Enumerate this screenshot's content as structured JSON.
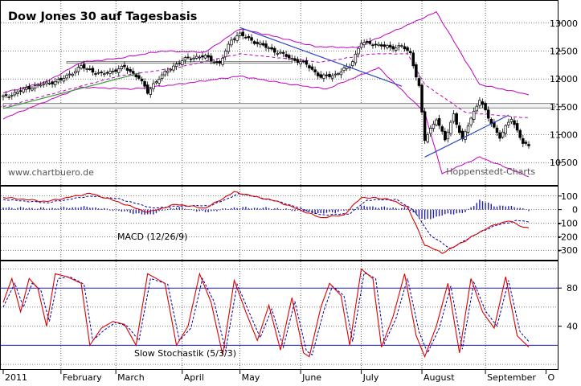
{
  "chart_data": [
    {
      "type": "candlestick",
      "title": "Dow Jones 30 auf Tagesbasis",
      "watermark": "www.chartbuero.de",
      "source": "Hoppenstedt-Charts",
      "ylim": [
        10100,
        13400
      ],
      "yticks": [
        10500,
        11000,
        11500,
        12000,
        12500,
        13000
      ],
      "xlim": [
        0,
        182
      ],
      "months": [
        {
          "label": "2011",
          "index": 0
        },
        {
          "label": "February",
          "index": 20
        },
        {
          "label": "March",
          "index": 39
        },
        {
          "label": "April",
          "index": 62
        },
        {
          "label": "May",
          "index": 82
        },
        {
          "label": "June",
          "index": 103
        },
        {
          "label": "July",
          "index": 124
        },
        {
          "label": "August",
          "index": 145
        },
        {
          "label": "September",
          "index": 167
        },
        {
          "label": "O",
          "index": 188
        }
      ],
      "close_keypoints": [
        [
          0,
          11670
        ],
        [
          10,
          11860
        ],
        [
          20,
          11980
        ],
        [
          27,
          12220
        ],
        [
          34,
          12080
        ],
        [
          42,
          12210
        ],
        [
          47,
          12020
        ],
        [
          50,
          11760
        ],
        [
          52,
          11910
        ],
        [
          58,
          12200
        ],
        [
          64,
          12380
        ],
        [
          70,
          12400
        ],
        [
          75,
          12270
        ],
        [
          79,
          12710
        ],
        [
          82,
          12800
        ],
        [
          88,
          12640
        ],
        [
          95,
          12480
        ],
        [
          100,
          12360
        ],
        [
          105,
          12260
        ],
        [
          110,
          12030
        ],
        [
          115,
          12080
        ],
        [
          120,
          12230
        ],
        [
          124,
          12650
        ],
        [
          128,
          12630
        ],
        [
          134,
          12560
        ],
        [
          138,
          12590
        ],
        [
          141,
          12450
        ],
        [
          144,
          11870
        ],
        [
          146,
          10900
        ],
        [
          150,
          11300
        ],
        [
          153,
          10900
        ],
        [
          156,
          11370
        ],
        [
          159,
          10900
        ],
        [
          162,
          11300
        ],
        [
          165,
          11640
        ],
        [
          168,
          11300
        ],
        [
          172,
          10960
        ],
        [
          176,
          11300
        ],
        [
          180,
          10850
        ],
        [
          182,
          10780
        ]
      ],
      "moving_average_keypoints": [
        [
          0,
          11500
        ],
        [
          40,
          12050
        ],
        [
          60,
          12200
        ],
        [
          82,
          12450
        ],
        [
          110,
          12300
        ],
        [
          128,
          12450
        ],
        [
          140,
          12450
        ],
        [
          146,
          11900
        ],
        [
          160,
          11400
        ],
        [
          182,
          11300
        ]
      ],
      "bollinger_upper_keypoints": [
        [
          0,
          11750
        ],
        [
          15,
          11950
        ],
        [
          27,
          12300
        ],
        [
          40,
          12370
        ],
        [
          55,
          12500
        ],
        [
          70,
          12480
        ],
        [
          82,
          12900
        ],
        [
          95,
          12750
        ],
        [
          108,
          12580
        ],
        [
          122,
          12560
        ],
        [
          135,
          12850
        ],
        [
          150,
          13200
        ],
        [
          165,
          11900
        ],
        [
          182,
          11720
        ]
      ],
      "bollinger_lower_keypoints": [
        [
          0,
          11290
        ],
        [
          27,
          11850
        ],
        [
          45,
          11820
        ],
        [
          60,
          11900
        ],
        [
          82,
          12050
        ],
        [
          100,
          11900
        ],
        [
          112,
          11820
        ],
        [
          130,
          12200
        ],
        [
          146,
          11400
        ],
        [
          152,
          10300
        ],
        [
          165,
          10600
        ],
        [
          182,
          10250
        ]
      ],
      "trendlines": [
        {
          "color": "#3b9a3b",
          "points": [
            [
              0,
              11470
            ],
            [
              47,
              12100
            ]
          ]
        },
        {
          "color": "#2a45c8",
          "points": [
            [
              82,
              12920
            ],
            [
              138,
              11870
            ]
          ]
        },
        {
          "color": "#2a45c8",
          "points": [
            [
              146,
              10600
            ],
            [
              175,
              11350
            ]
          ]
        }
      ],
      "resistance_bands": [
        {
          "from": [
            22,
            12290
          ],
          "to": [
            100,
            12310
          ]
        },
        {
          "from": [
            0,
            11480
          ],
          "to": [
            182,
            11560
          ]
        }
      ]
    },
    {
      "type": "bar+line",
      "label": "MACD (12/26/9)",
      "ylim": [
        -370,
        170
      ],
      "yticks": [
        100,
        0,
        -100,
        -200,
        -300
      ],
      "macd_keypoints": [
        [
          0,
          90
        ],
        [
          15,
          60
        ],
        [
          30,
          120
        ],
        [
          38,
          70
        ],
        [
          50,
          -20
        ],
        [
          60,
          40
        ],
        [
          70,
          10
        ],
        [
          80,
          130
        ],
        [
          95,
          60
        ],
        [
          110,
          -60
        ],
        [
          118,
          -40
        ],
        [
          124,
          90
        ],
        [
          133,
          80
        ],
        [
          140,
          20
        ],
        [
          146,
          -260
        ],
        [
          152,
          -320
        ],
        [
          160,
          -230
        ],
        [
          168,
          -130
        ],
        [
          175,
          -80
        ],
        [
          180,
          -130
        ]
      ],
      "signal_keypoints": [
        [
          0,
          75
        ],
        [
          15,
          50
        ],
        [
          30,
          100
        ],
        [
          40,
          80
        ],
        [
          52,
          10
        ],
        [
          60,
          25
        ],
        [
          72,
          30
        ],
        [
          82,
          120
        ],
        [
          97,
          50
        ],
        [
          110,
          -40
        ],
        [
          120,
          -30
        ],
        [
          126,
          70
        ],
        [
          136,
          75
        ],
        [
          142,
          0
        ],
        [
          148,
          -190
        ],
        [
          155,
          -290
        ],
        [
          162,
          -200
        ],
        [
          170,
          -120
        ],
        [
          178,
          -80
        ],
        [
          182,
          -90
        ]
      ],
      "histogram_keypoints": [
        [
          0,
          15
        ],
        [
          15,
          10
        ],
        [
          30,
          20
        ],
        [
          40,
          -10
        ],
        [
          50,
          -40
        ],
        [
          60,
          20
        ],
        [
          70,
          -20
        ],
        [
          80,
          15
        ],
        [
          95,
          10
        ],
        [
          110,
          -30
        ],
        [
          118,
          -10
        ],
        [
          125,
          25
        ],
        [
          133,
          15
        ],
        [
          140,
          10
        ],
        [
          146,
          -80
        ],
        [
          152,
          -40
        ],
        [
          160,
          -20
        ],
        [
          165,
          70
        ],
        [
          170,
          30
        ],
        [
          178,
          20
        ],
        [
          182,
          -10
        ]
      ]
    },
    {
      "type": "line",
      "label": "Slow Stochastik (5/3/3)",
      "ylim": [
        -5,
        108
      ],
      "yticks": [
        80,
        40
      ],
      "reference_lines": [
        80,
        20
      ],
      "k_keypoints": [
        [
          0,
          65
        ],
        [
          3,
          90
        ],
        [
          6,
          55
        ],
        [
          9,
          90
        ],
        [
          12,
          80
        ],
        [
          15,
          40
        ],
        [
          18,
          95
        ],
        [
          22,
          92
        ],
        [
          27,
          85
        ],
        [
          30,
          20
        ],
        [
          34,
          38
        ],
        [
          38,
          45
        ],
        [
          42,
          42
        ],
        [
          46,
          20
        ],
        [
          50,
          95
        ],
        [
          56,
          85
        ],
        [
          60,
          20
        ],
        [
          64,
          40
        ],
        [
          68,
          95
        ],
        [
          72,
          65
        ],
        [
          76,
          10
        ],
        [
          80,
          88
        ],
        [
          84,
          55
        ],
        [
          88,
          25
        ],
        [
          92,
          62
        ],
        [
          96,
          15
        ],
        [
          100,
          70
        ],
        [
          104,
          12
        ],
        [
          106,
          8
        ],
        [
          110,
          60
        ],
        [
          113,
          85
        ],
        [
          117,
          72
        ],
        [
          120,
          20
        ],
        [
          124,
          100
        ],
        [
          128,
          90
        ],
        [
          131,
          18
        ],
        [
          135,
          50
        ],
        [
          139,
          95
        ],
        [
          143,
          30
        ],
        [
          146,
          8
        ],
        [
          150,
          40
        ],
        [
          154,
          85
        ],
        [
          158,
          12
        ],
        [
          162,
          90
        ],
        [
          166,
          55
        ],
        [
          170,
          38
        ],
        [
          174,
          92
        ],
        [
          178,
          30
        ],
        [
          182,
          18
        ]
      ],
      "d_keypoints": [
        [
          0,
          60
        ],
        [
          4,
          85
        ],
        [
          7,
          60
        ],
        [
          10,
          85
        ],
        [
          13,
          78
        ],
        [
          16,
          45
        ],
        [
          19,
          90
        ],
        [
          23,
          92
        ],
        [
          28,
          84
        ],
        [
          31,
          25
        ],
        [
          35,
          36
        ],
        [
          39,
          44
        ],
        [
          43,
          40
        ],
        [
          47,
          25
        ],
        [
          51,
          90
        ],
        [
          57,
          84
        ],
        [
          61,
          25
        ],
        [
          65,
          38
        ],
        [
          69,
          90
        ],
        [
          73,
          66
        ],
        [
          77,
          14
        ],
        [
          81,
          84
        ],
        [
          85,
          56
        ],
        [
          89,
          28
        ],
        [
          93,
          58
        ],
        [
          97,
          18
        ],
        [
          101,
          66
        ],
        [
          105,
          14
        ],
        [
          107,
          10
        ],
        [
          111,
          56
        ],
        [
          114,
          82
        ],
        [
          118,
          72
        ],
        [
          121,
          24
        ],
        [
          125,
          96
        ],
        [
          129,
          90
        ],
        [
          132,
          22
        ],
        [
          136,
          48
        ],
        [
          140,
          90
        ],
        [
          144,
          34
        ],
        [
          147,
          12
        ],
        [
          151,
          38
        ],
        [
          155,
          82
        ],
        [
          159,
          16
        ],
        [
          163,
          86
        ],
        [
          167,
          56
        ],
        [
          171,
          40
        ],
        [
          175,
          88
        ],
        [
          179,
          34
        ],
        [
          182,
          24
        ]
      ]
    }
  ],
  "colors": {
    "background": "#ffffff",
    "candle": "#000000",
    "moving_average": "#c000c0",
    "bollinger": "#c000c0",
    "macd": "#dd0000",
    "signal": "#0000a0",
    "histogram": "#2020b0",
    "stoch_k": "#dd0000",
    "stoch_d": "#0000a0",
    "reference": "#1a1ab0",
    "grid": "#000000"
  }
}
